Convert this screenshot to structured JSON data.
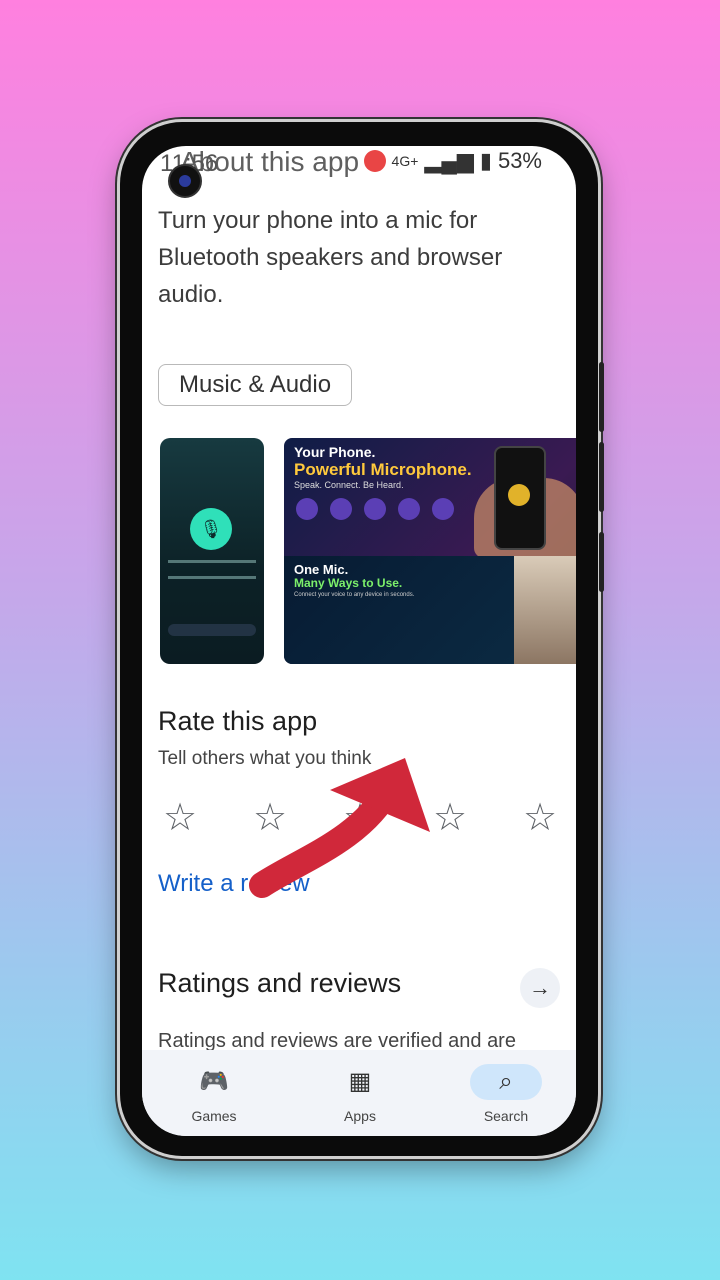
{
  "status": {
    "time": "11:56",
    "heading_ghost": "About this app",
    "network": "4G+",
    "battery": "53%"
  },
  "about": {
    "description": "Turn your phone into a mic for Bluetooth speakers and browser audio.",
    "category_chip": "Music & Audio"
  },
  "screenshots": {
    "shot2": {
      "top_title": "Your Phone.",
      "top_headline": "Powerful Microphone.",
      "top_tagline": "Speak. Connect. Be Heard.",
      "bottom_title": "One Mic.",
      "bottom_headline": "Many Ways to Use.",
      "bottom_tagline": "Connect your voice to any device in seconds."
    }
  },
  "rate": {
    "title": "Rate this app",
    "subtitle": "Tell others what you think",
    "stars": 5,
    "write_review": "Write a review"
  },
  "ratings": {
    "title": "Ratings and reviews",
    "subtitle": "Ratings and reviews are verified and are"
  },
  "nav": {
    "items": [
      {
        "icon": "gamepad-icon",
        "label": "Games"
      },
      {
        "icon": "apps-icon",
        "label": "Apps"
      },
      {
        "icon": "search-icon",
        "label": "Search"
      }
    ]
  },
  "colors": {
    "link": "#1560c9",
    "annotation_arrow": "#d0283a",
    "nav_active": "#cfe6fb"
  }
}
